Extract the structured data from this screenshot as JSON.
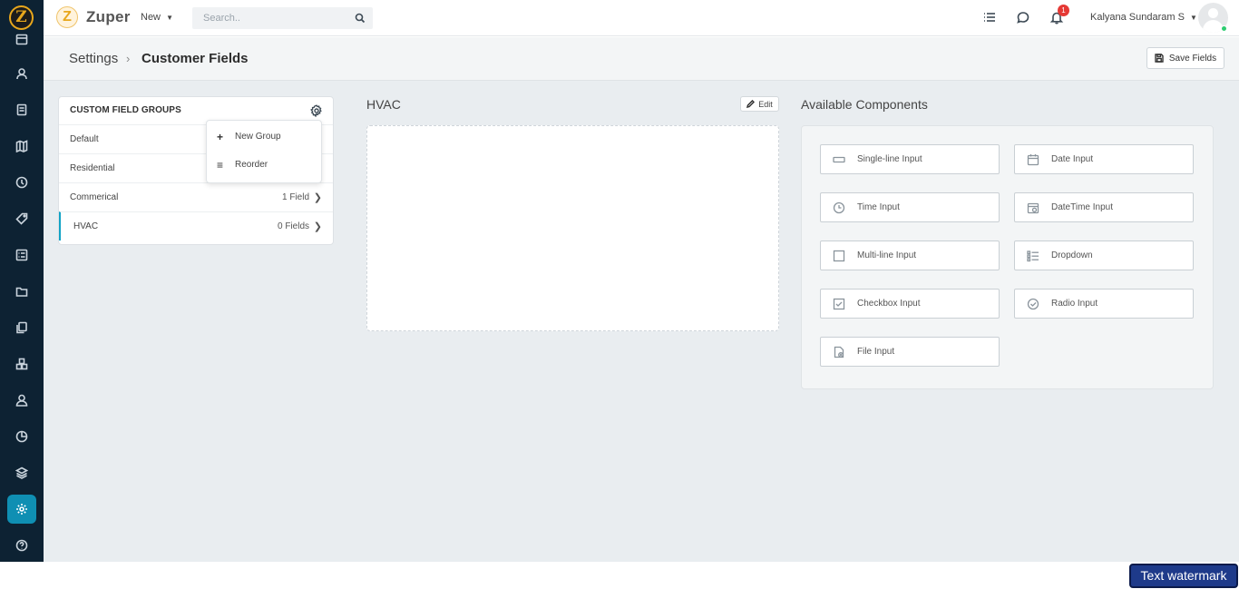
{
  "app": {
    "name": "Zuper",
    "logo_letter": "Z",
    "accent": "#0f8fb3"
  },
  "topbar": {
    "new_label": "New",
    "search_placeholder": "Search..",
    "notification_count": "1",
    "user_name": "Kalyana Sundaram S",
    "icons": [
      "list-icon",
      "chat-icon",
      "bell-icon"
    ]
  },
  "rail": {
    "items": [
      "calendar-icon",
      "customers-icon",
      "invoice-icon",
      "map-icon",
      "clock-icon",
      "tag-icon",
      "checklist-icon",
      "folder-icon",
      "documents-icon",
      "assets-icon",
      "user-icon",
      "timesheet-icon",
      "layers-icon",
      "settings-icon",
      "help-icon"
    ],
    "active": "settings-icon"
  },
  "breadcrumb": {
    "parent": "Settings",
    "separator": "›",
    "current": "Customer Fields"
  },
  "toolbar": {
    "save_label": "Save Fields"
  },
  "groups": {
    "header": "CUSTOM FIELD GROUPS",
    "items": [
      {
        "name": "Default",
        "count": ""
      },
      {
        "name": "Residential",
        "count": ""
      },
      {
        "name": "Commerical",
        "count": "1 Field"
      },
      {
        "name": "HVAC",
        "count": "0 Fields"
      }
    ],
    "selected": "HVAC"
  },
  "group_menu": {
    "items": [
      {
        "label": "New Group",
        "icon": "+"
      },
      {
        "label": "Reorder",
        "icon": "≡"
      }
    ]
  },
  "editor": {
    "title": "HVAC",
    "edit_label": "Edit"
  },
  "components": {
    "title": "Available Components",
    "items": [
      {
        "label": "Single-line Input",
        "icon": "single-line-input-icon"
      },
      {
        "label": "Date Input",
        "icon": "date-input-icon"
      },
      {
        "label": "Time Input",
        "icon": "time-input-icon"
      },
      {
        "label": "DateTime Input",
        "icon": "datetime-input-icon"
      },
      {
        "label": "Multi-line Input",
        "icon": "multi-line-input-icon"
      },
      {
        "label": "Dropdown",
        "icon": "dropdown-icon"
      },
      {
        "label": "Checkbox Input",
        "icon": "checkbox-input-icon"
      },
      {
        "label": "Radio Input",
        "icon": "radio-input-icon"
      },
      {
        "label": "File Input",
        "icon": "file-input-icon"
      }
    ]
  },
  "watermark": "Text watermark"
}
